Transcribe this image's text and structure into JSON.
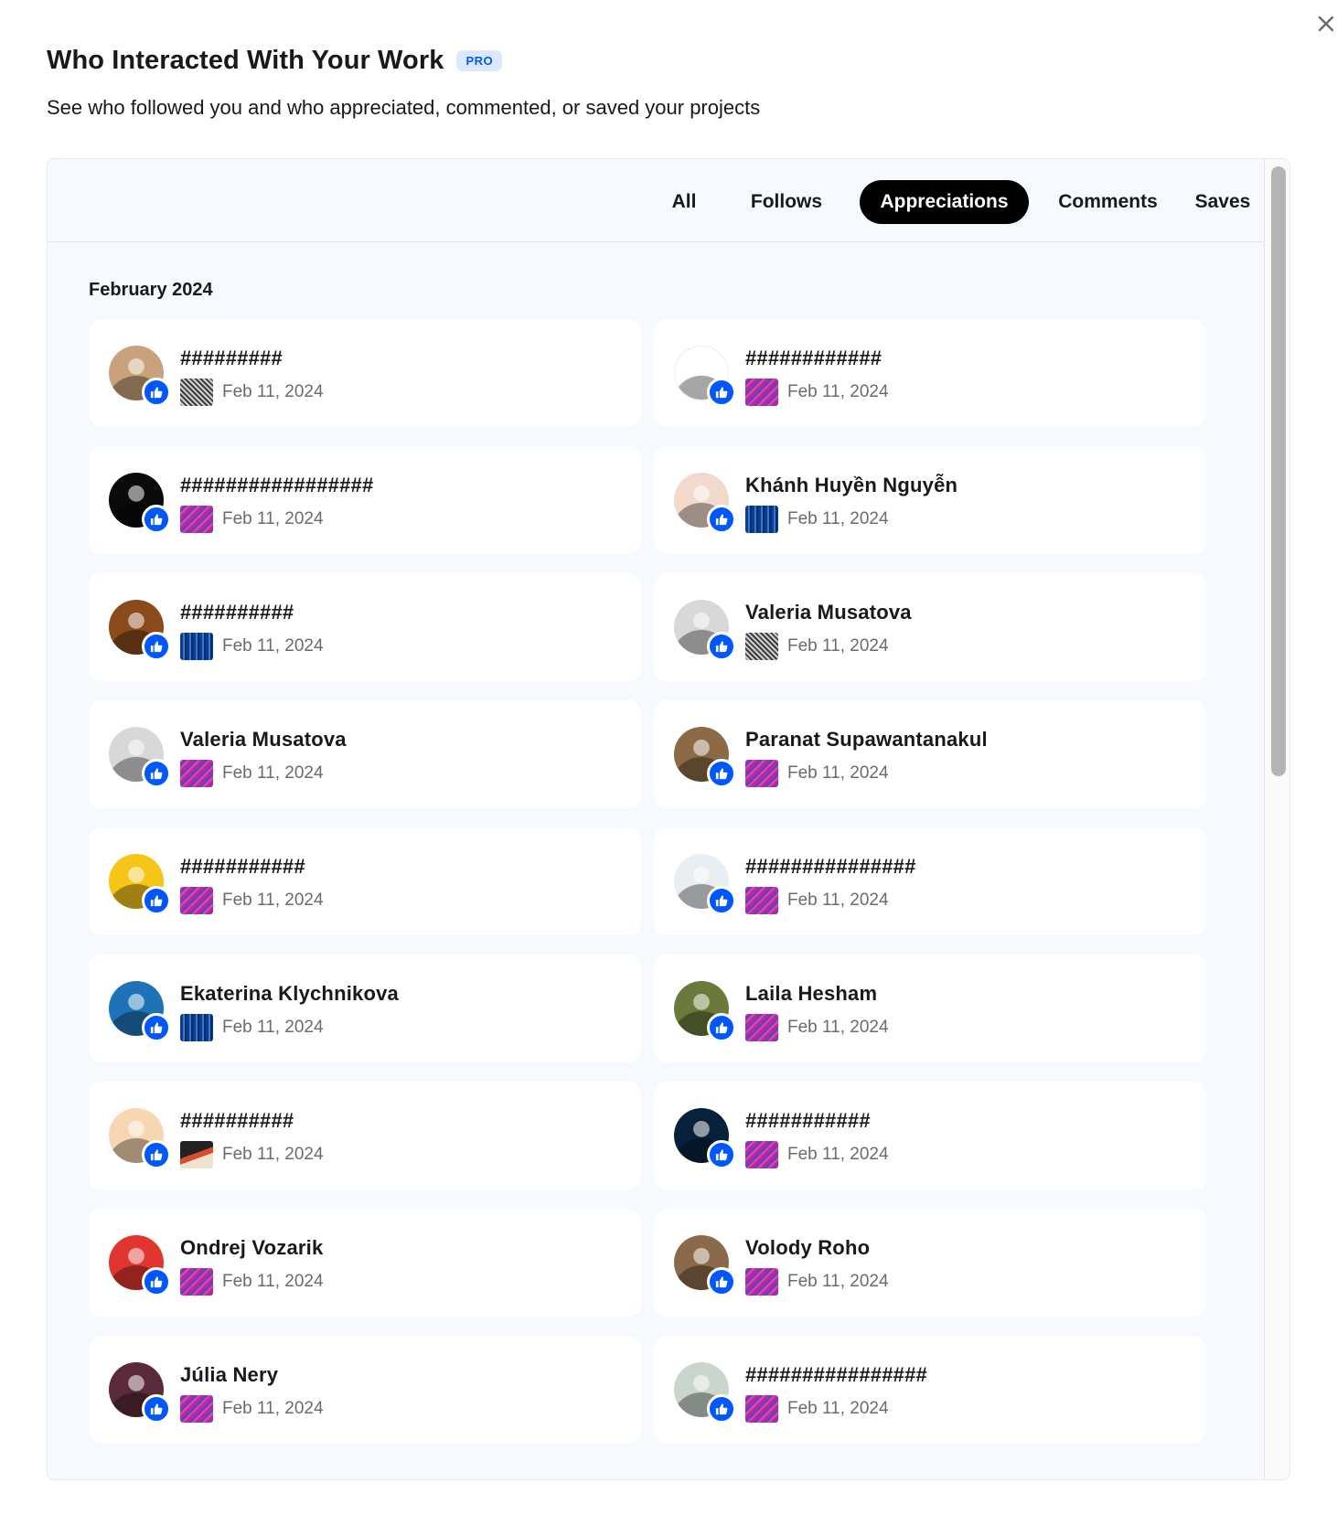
{
  "modal": {
    "title": "Who Interacted With Your Work",
    "badge": "PRO",
    "subtitle": "See who followed you and who appreciated, commented, or saved your projects",
    "close_icon": "close-icon"
  },
  "tabs": [
    {
      "label": "All",
      "active": false
    },
    {
      "label": "Follows",
      "active": false
    },
    {
      "label": "Appreciations",
      "active": true
    },
    {
      "label": "Comments",
      "active": false
    },
    {
      "label": "Saves",
      "active": false
    }
  ],
  "month_heading": "February 2024",
  "colors": {
    "accent": "#0057ff",
    "panel_bg": "#f6f9fd",
    "active_tab": "#000000"
  },
  "thumb_styles": {
    "sketch": "gray-pattern",
    "purple": "purple-pink-pattern",
    "blue": "blue-pattern",
    "dark": "dark-orange-pattern"
  },
  "activities": [
    {
      "name": "#########",
      "date": "Feb 11, 2024",
      "thumb": "sketch",
      "avatar": "#c9a27b"
    },
    {
      "name": "############",
      "date": "Feb 11, 2024",
      "thumb": "purple",
      "avatar": "#ffffff"
    },
    {
      "name": "#################",
      "date": "Feb 11, 2024",
      "thumb": "purple",
      "avatar": "#0a0a0a"
    },
    {
      "name": "Khánh Huyền Nguyễn",
      "date": "Feb 11, 2024",
      "thumb": "blue",
      "avatar": "#f1d9cc"
    },
    {
      "name": "##########",
      "date": "Feb 11, 2024",
      "thumb": "blue",
      "avatar": "#8a4a1c"
    },
    {
      "name": "Valeria Musatova",
      "date": "Feb 11, 2024",
      "thumb": "sketch",
      "avatar": "#d8d8d8"
    },
    {
      "name": "Valeria Musatova",
      "date": "Feb 11, 2024",
      "thumb": "purple",
      "avatar": "#d8d8d8"
    },
    {
      "name": "Paranat Supawantanakul",
      "date": "Feb 11, 2024",
      "thumb": "purple",
      "avatar": "#8b6a45"
    },
    {
      "name": "###########",
      "date": "Feb 11, 2024",
      "thumb": "purple",
      "avatar": "#f5c518"
    },
    {
      "name": "###############",
      "date": "Feb 11, 2024",
      "thumb": "purple",
      "avatar": "#e8eef2"
    },
    {
      "name": "Ekaterina Klychnikova",
      "date": "Feb 11, 2024",
      "thumb": "blue",
      "avatar": "#1e73b8"
    },
    {
      "name": "Laila Hesham",
      "date": "Feb 11, 2024",
      "thumb": "purple",
      "avatar": "#6a7a3b"
    },
    {
      "name": "##########",
      "date": "Feb 11, 2024",
      "thumb": "dark",
      "avatar": "#f6d7b2"
    },
    {
      "name": "###########",
      "date": "Feb 11, 2024",
      "thumb": "purple",
      "avatar": "#08213a"
    },
    {
      "name": "Ondrej Vozarik",
      "date": "Feb 11, 2024",
      "thumb": "purple",
      "avatar": "#e0362f"
    },
    {
      "name": "Volody Roho",
      "date": "Feb 11, 2024",
      "thumb": "purple",
      "avatar": "#8a6a4a"
    },
    {
      "name": "Júlia Nery",
      "date": "Feb 11, 2024",
      "thumb": "purple",
      "avatar": "#5a2a3a"
    },
    {
      "name": "################",
      "date": "Feb 11, 2024",
      "thumb": "purple",
      "avatar": "#c8d6cc"
    }
  ]
}
